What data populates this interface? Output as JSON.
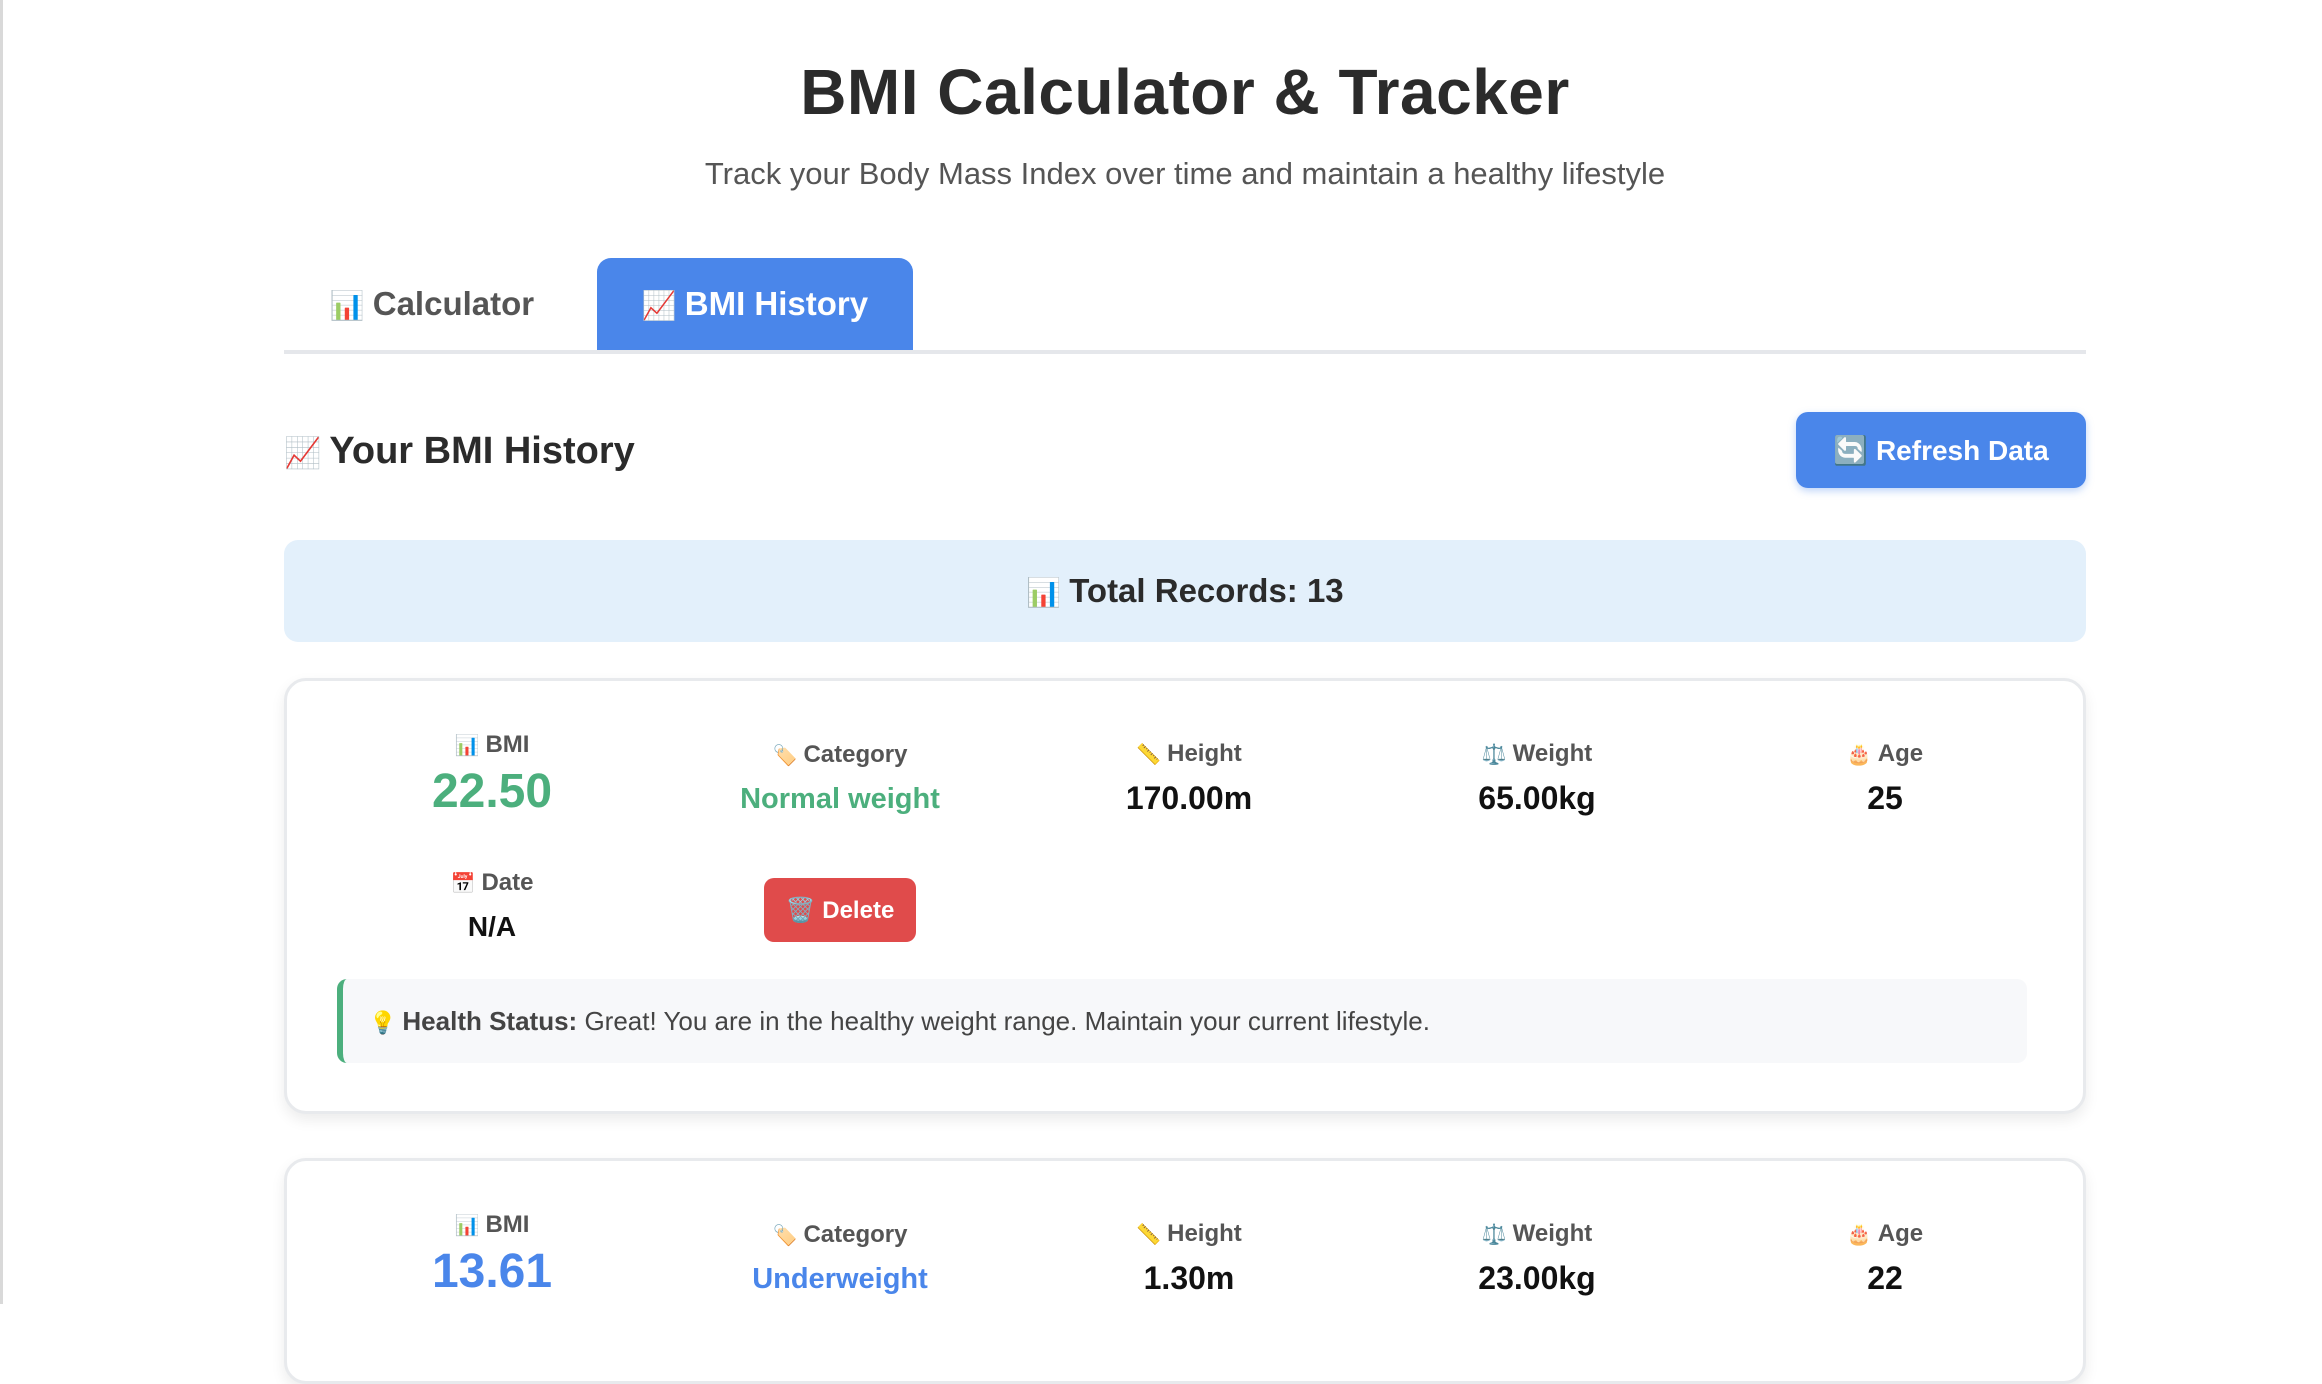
{
  "header": {
    "title": "BMI Calculator & Tracker",
    "subtitle": "Track your Body Mass Index over time and maintain a healthy lifestyle"
  },
  "tabs": [
    {
      "icon": "📊",
      "label": "Calculator",
      "active": false
    },
    {
      "icon": "📈",
      "label": "BMI History",
      "active": true
    }
  ],
  "history": {
    "icon": "📈",
    "title": "Your BMI History",
    "refresh_icon": "🔄",
    "refresh_label": "Refresh Data",
    "total_icon": "📊",
    "total_label": "Total Records: 13"
  },
  "labels": {
    "bmi": "BMI",
    "bmi_icon": "📊",
    "category": "Category",
    "category_icon": "🏷️",
    "height": "Height",
    "height_icon": "📏",
    "weight": "Weight",
    "weight_icon": "⚖️",
    "age": "Age",
    "age_icon": "🎂",
    "date": "Date",
    "date_icon": "📅",
    "delete": "Delete",
    "delete_icon": "🗑️",
    "status_icon": "💡",
    "status_prefix": "Health Status:"
  },
  "records": [
    {
      "bmi": "22.50",
      "category": "Normal weight",
      "height": "170.00m",
      "weight": "65.00kg",
      "age": "25",
      "date": "N/A",
      "status": "Great! You are in the healthy weight range. Maintain your current lifestyle.",
      "color": "#4caf7d"
    },
    {
      "bmi": "13.61",
      "category": "Underweight",
      "height": "1.30m",
      "weight": "23.00kg",
      "age": "22",
      "color": "#4a86ea"
    }
  ],
  "colors": {
    "primary": "#4a86ea",
    "normal": "#4caf7d",
    "danger": "#e04b4b",
    "info_bg": "#e3f0fb"
  }
}
